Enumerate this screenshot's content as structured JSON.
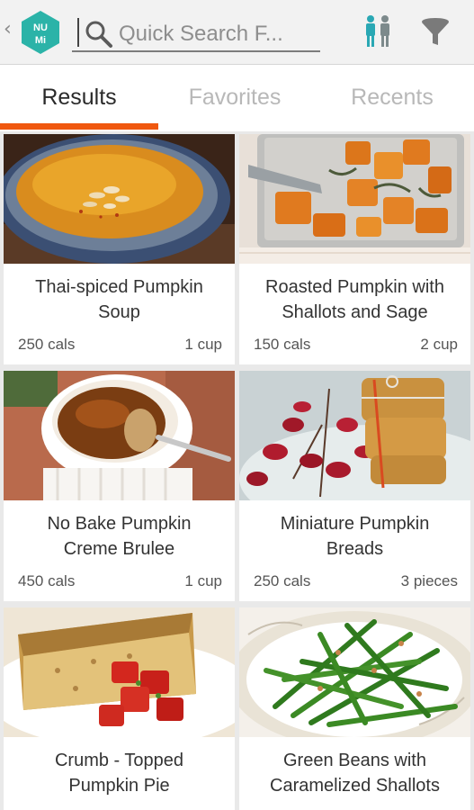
{
  "header": {
    "back_glyph": "‹",
    "logo_text_top": "NU",
    "logo_text_bottom": "Mi",
    "search_placeholder": "Quick Search F...",
    "icons": [
      "back-arrow-icon",
      "numi-logo-icon",
      "search-icon",
      "people-icon",
      "filter-icon"
    ]
  },
  "tabs": [
    {
      "label": "Results",
      "active": true
    },
    {
      "label": "Favorites",
      "active": false
    },
    {
      "label": "Recents",
      "active": false
    }
  ],
  "results": [
    {
      "title_line1": "Thai-spiced Pumpkin",
      "title_line2": "Soup",
      "cals": "250 cals",
      "amount": "1 cup"
    },
    {
      "title_line1": "Roasted Pumpkin with",
      "title_line2": "Shallots and Sage",
      "cals": "150 cals",
      "amount": "2 cup"
    },
    {
      "title_line1": "No Bake Pumpkin",
      "title_line2": "Creme Brulee",
      "cals": "450 cals",
      "amount": "1 cup"
    },
    {
      "title_line1": "Miniature Pumpkin",
      "title_line2": "Breads",
      "cals": "250 cals",
      "amount": "3 pieces"
    },
    {
      "title_line1": "Crumb - Topped",
      "title_line2": "Pumpkin Pie",
      "cals": "",
      "amount": ""
    },
    {
      "title_line1": "Green Beans with",
      "title_line2": "Caramelized Shallots",
      "cals": "",
      "amount": ""
    }
  ],
  "colors": {
    "accent": "#f0580f",
    "logo": "#2bb3a8",
    "people_icon": "#2aa8b4",
    "filter_icon": "#7a7a7a"
  }
}
